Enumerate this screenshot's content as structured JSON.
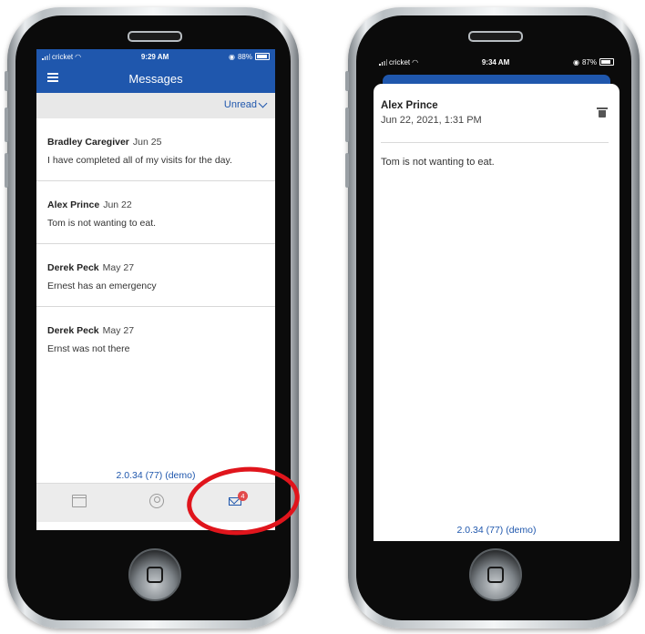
{
  "left_screen": {
    "status": {
      "carrier": "cricket",
      "time": "9:29 AM",
      "battery": "88%",
      "battery_level": 0.88
    },
    "appbar": {
      "title": "Messages"
    },
    "filter": {
      "label": "Unread"
    },
    "messages": [
      {
        "sender": "Bradley Caregiver",
        "date": "Jun 25",
        "preview": "I have completed all of my visits for the day."
      },
      {
        "sender": "Alex Prince",
        "date": "Jun 22",
        "preview": "Tom is not wanting to eat."
      },
      {
        "sender": "Derek Peck",
        "date": "May 27",
        "preview": "Ernest has an emergency"
      },
      {
        "sender": "Derek Peck",
        "date": "May 27",
        "preview": "Ernst was not there"
      }
    ],
    "version": "2.0.34 (77) (demo)",
    "tabbar": {
      "tabs": [
        {
          "icon": "calendar-icon"
        },
        {
          "icon": "profile-icon"
        },
        {
          "icon": "mail-icon",
          "badge": "4",
          "active_color": "#1f57ad"
        }
      ]
    },
    "highlight_color": "#e0151c"
  },
  "right_screen": {
    "status": {
      "carrier": "cricket",
      "time": "9:34 AM",
      "battery": "87%",
      "battery_level": 0.87
    },
    "message": {
      "sender": "Alex Prince",
      "timestamp": "Jun 22, 2021, 1:31 PM",
      "body": "Tom is not wanting to eat."
    },
    "version": "2.0.34 (77) (demo)"
  },
  "colors": {
    "primary": "#1f57ad",
    "badge": "#e24a4a"
  }
}
